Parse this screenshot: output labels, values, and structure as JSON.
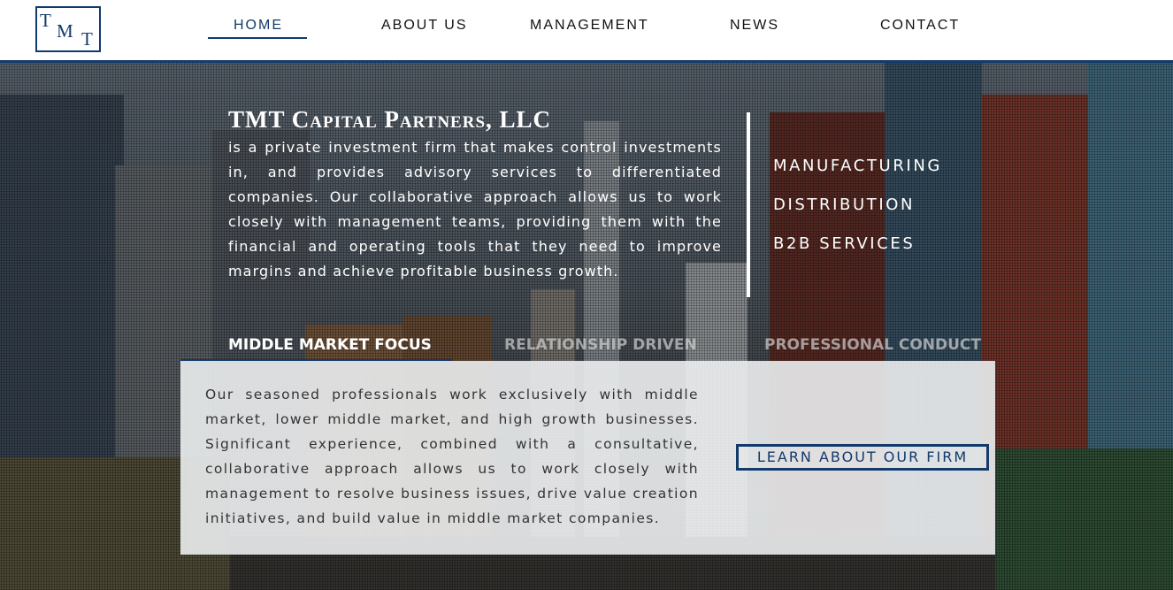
{
  "logo": {
    "letters": [
      "T",
      "M",
      "T"
    ]
  },
  "nav": {
    "items": [
      {
        "label": "HOME",
        "active": true
      },
      {
        "label": "ABOUT US",
        "active": false
      },
      {
        "label": "MANAGEMENT",
        "active": false
      },
      {
        "label": "NEWS",
        "active": false
      },
      {
        "label": "CONTACT",
        "active": false
      }
    ]
  },
  "intro": {
    "title": "TMT Capital Partners, LLC",
    "body": "is a private investment firm that makes control investments in, and provides advisory services to differentiated companies. Our collaborative approach allows us to work closely with management teams, providing them with the financial and operating tools that they need to improve margins and achieve profitable business growth."
  },
  "sectors": [
    "MANUFACTURING",
    "DISTRIBUTION",
    "B2B SERVICES"
  ],
  "tabs": [
    {
      "label": "MIDDLE MARKET FOCUS",
      "active": true
    },
    {
      "label": "RELATIONSHIP DRIVEN",
      "active": false
    },
    {
      "label": "PROFESSIONAL CONDUCT",
      "active": false
    }
  ],
  "panel": {
    "text": "Our seasoned professionals work exclusively with middle market, lower middle market, and high growth businesses. Significant experience, combined with a consultative, collaborative approach allows us to work closely with management to resolve business issues, drive value creation initiatives, and build value in middle market companies.",
    "cta_label": "LEARN ABOUT OUR FIRM"
  },
  "colors": {
    "brand": "#123a6b",
    "header_bg": "#ffffff",
    "panel_bg": "#eceef0"
  }
}
